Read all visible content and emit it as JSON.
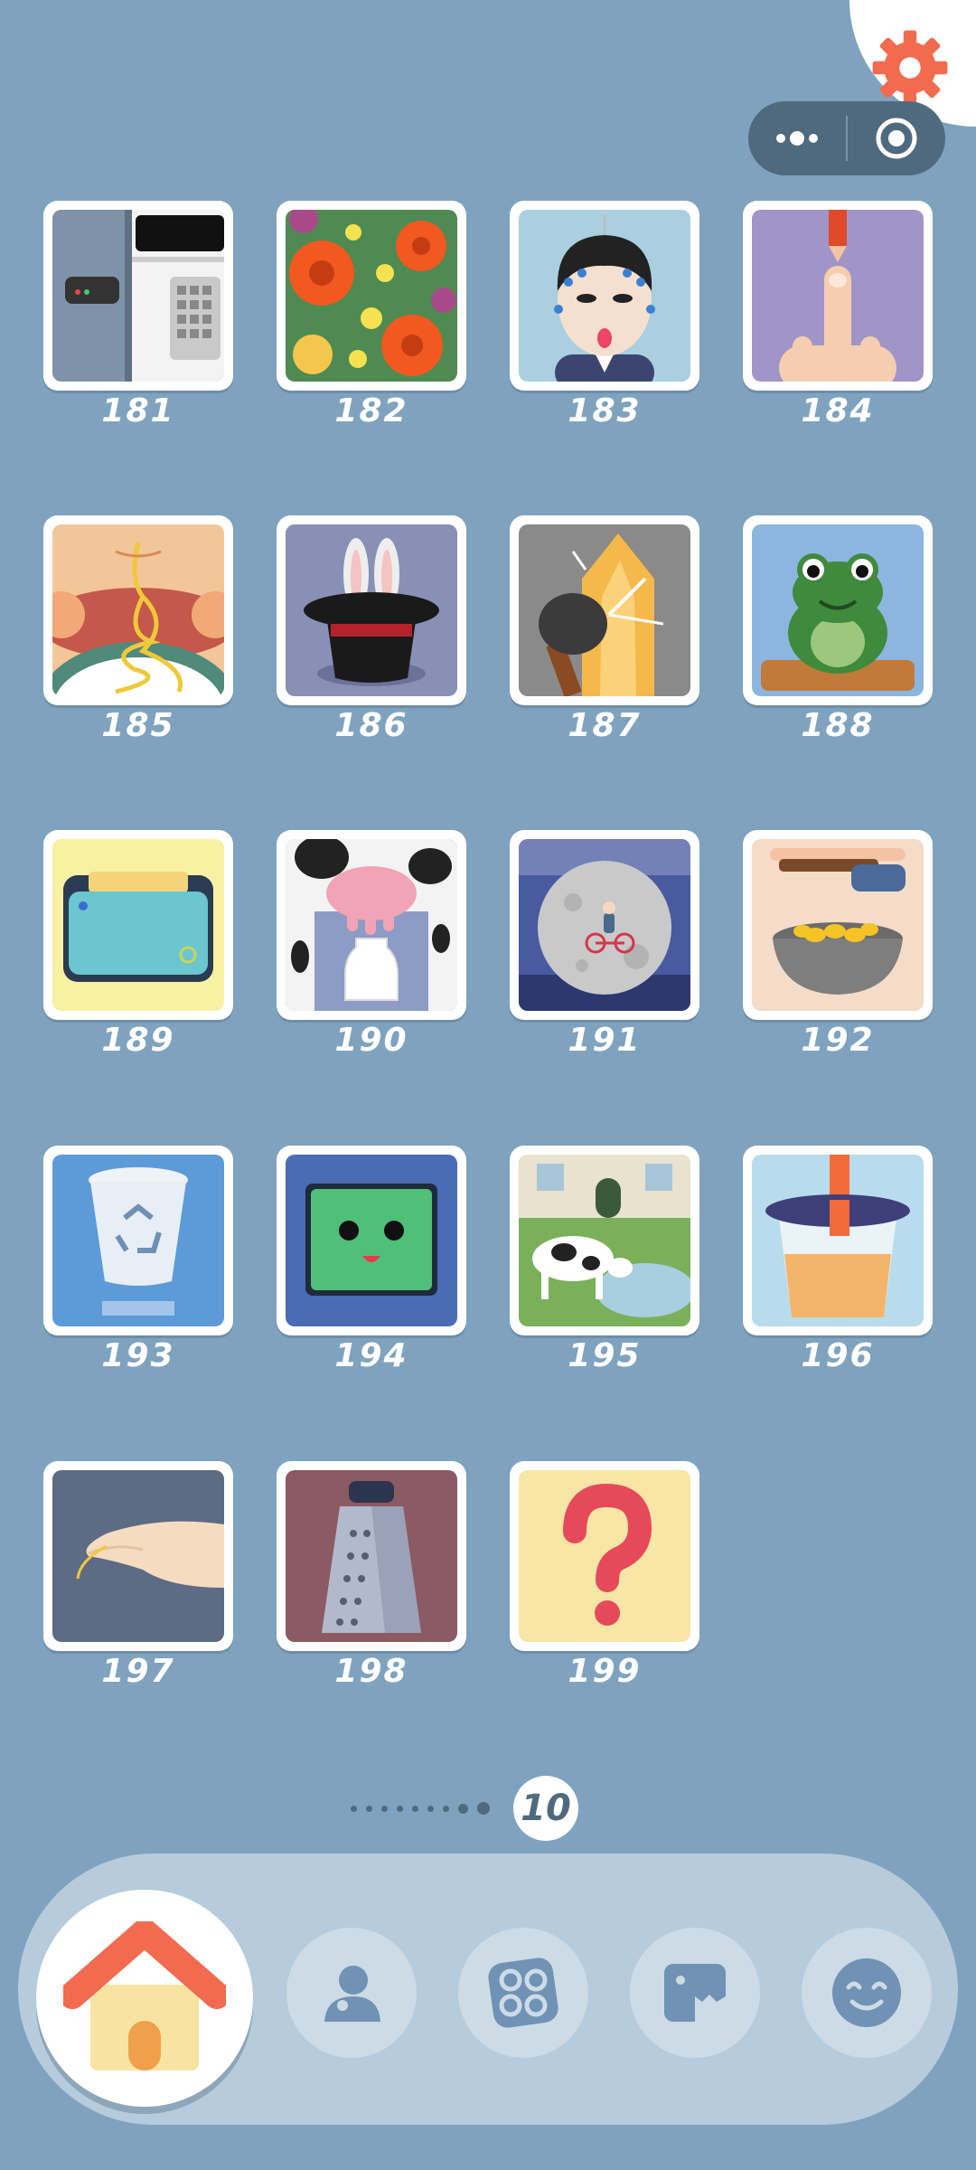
{
  "header": {
    "settings_icon": "gear-icon",
    "capsule": {
      "more_icon": "more-dots-icon",
      "close_icon": "target-close-icon"
    }
  },
  "levels": [
    {
      "number": "181",
      "art": "fridge-icon"
    },
    {
      "number": "182",
      "art": "flowers-icon"
    },
    {
      "number": "183",
      "art": "acupuncture-man-icon"
    },
    {
      "number": "184",
      "art": "finger-pen-icon"
    },
    {
      "number": "185",
      "art": "noodle-mouth-icon"
    },
    {
      "number": "186",
      "art": "magic-hat-rabbit-icon"
    },
    {
      "number": "187",
      "art": "hammer-ice-icon"
    },
    {
      "number": "188",
      "art": "frog-icon"
    },
    {
      "number": "189",
      "art": "wallet-icon"
    },
    {
      "number": "190",
      "art": "cow-milk-icon"
    },
    {
      "number": "191",
      "art": "moon-bicycle-icon"
    },
    {
      "number": "192",
      "art": "coin-bowl-icon"
    },
    {
      "number": "193",
      "art": "recycle-bin-icon"
    },
    {
      "number": "194",
      "art": "green-face-box-icon"
    },
    {
      "number": "195",
      "art": "cow-farm-icon"
    },
    {
      "number": "196",
      "art": "drink-cup-icon"
    },
    {
      "number": "197",
      "art": "hand-thread-icon"
    },
    {
      "number": "198",
      "art": "grater-icon"
    },
    {
      "number": "199",
      "art": "question-mark-icon"
    }
  ],
  "pager": {
    "current_page": "10"
  },
  "nav": {
    "items": [
      {
        "name": "home",
        "icon": "home-icon",
        "active": true
      },
      {
        "name": "profile",
        "icon": "user-icon"
      },
      {
        "name": "levels",
        "icon": "grid-circles-icon"
      },
      {
        "name": "gallery",
        "icon": "photo-monster-icon"
      },
      {
        "name": "emoji",
        "icon": "smile-icon"
      }
    ]
  },
  "colors": {
    "background": "#7fa3bf",
    "accent": "#f26b4f",
    "nav_bar": "#b6ccdc",
    "tile_border": "#ffffff"
  }
}
